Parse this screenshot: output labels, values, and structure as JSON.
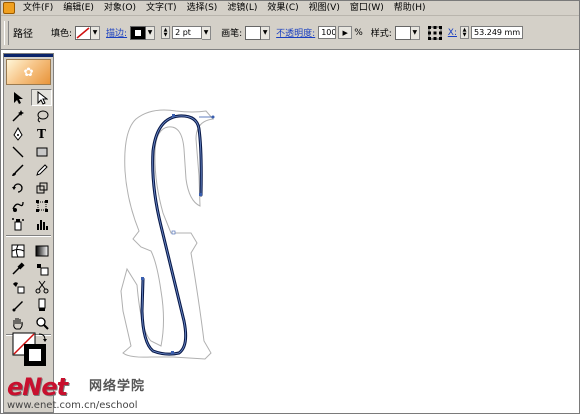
{
  "menubar": {
    "items": [
      "文件(F)",
      "编辑(E)",
      "对象(O)",
      "文字(T)",
      "选择(S)",
      "滤镜(L)",
      "效果(C)",
      "视图(V)",
      "窗口(W)",
      "帮助(H)"
    ]
  },
  "controlbar": {
    "selection_type": "路径",
    "fill_label": "填色:",
    "stroke_label": "描边:",
    "stroke_weight": "2 pt",
    "brush_label": "画笔:",
    "opacity_label": "不透明度:",
    "opacity_value": "100",
    "opacity_unit": "%",
    "style_label": "样式:",
    "x_label": "X:",
    "x_value": "53.249 mm"
  },
  "colors": {
    "chrome": "#d4d0c8",
    "path_stroke": "#0a1a4a",
    "path_highlight": "#6f8fcf",
    "outline": "#b0b0b0",
    "watermark_red": "#c8102e"
  },
  "tools": [
    {
      "left": "selection-arrow-icon",
      "right": "direct-selection-icon"
    },
    {
      "left": "magic-wand-icon",
      "right": "lasso-icon"
    },
    {
      "left": "pen-icon",
      "right": "type-icon"
    },
    {
      "left": "line-segment-icon",
      "right": "rectangle-icon"
    },
    {
      "left": "paintbrush-icon",
      "right": "pencil-icon"
    },
    {
      "left": "rotate-icon",
      "right": "scale-icon"
    },
    {
      "left": "warp-icon",
      "right": "free-transform-icon"
    },
    {
      "left": "symbol-sprayer-icon",
      "right": "column-graph-icon"
    },
    {
      "left": "mesh-icon",
      "right": "gradient-icon"
    },
    {
      "left": "eyedropper-icon",
      "right": "live-paint-icon"
    },
    {
      "left": "live-paint-selection-icon",
      "right": "scissors-icon"
    },
    {
      "left": "slice-icon",
      "right": "eraser-icon"
    },
    {
      "left": "hand-icon",
      "right": "zoom-icon"
    }
  ],
  "watermark": {
    "logo": "eNet",
    "subtitle": "网络学院",
    "url": "www.enet.com.cn/eschool"
  }
}
